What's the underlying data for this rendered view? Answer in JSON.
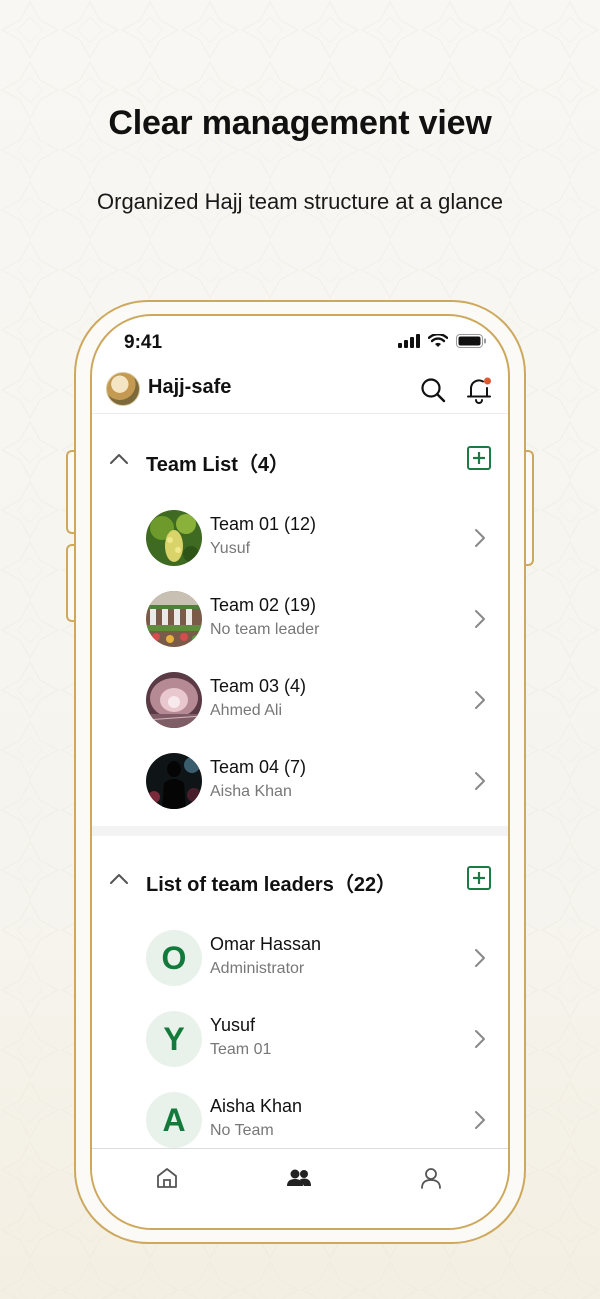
{
  "promo": {
    "headline": "Clear management view",
    "subline": "Organized Hajj team structure at a glance"
  },
  "status_bar": {
    "time": "9:41",
    "icons": [
      "signal-icon",
      "wifi-icon",
      "battery-icon"
    ]
  },
  "header": {
    "app_title": "Hajj-safe",
    "icons": [
      "search-icon",
      "bell-icon"
    ],
    "notification_dot_color": "#e0562f"
  },
  "team_list": {
    "title": "Team List（4）",
    "teams": [
      {
        "name": "Team 01 (12)",
        "leader": "Yusuf"
      },
      {
        "name": "Team 02 (19)",
        "leader": "No team leader"
      },
      {
        "name": "Team 03 (4)",
        "leader": "Ahmed Ali"
      },
      {
        "name": "Team 04 (7)",
        "leader": "Aisha Khan"
      }
    ]
  },
  "leaders_list": {
    "title": "List of team leaders（22）",
    "leaders": [
      {
        "initial": "O",
        "name": "Omar Hassan",
        "role": "Administrator"
      },
      {
        "initial": "Y",
        "name": "Yusuf",
        "role": "Team 01"
      },
      {
        "initial": "A",
        "name": "Aisha Khan",
        "role": "No Team"
      }
    ]
  },
  "tab_bar": {
    "tabs": [
      "home-icon",
      "team-icon",
      "profile-icon"
    ],
    "active": "team-icon"
  },
  "colors": {
    "accent_green": "#1c7a45",
    "frame_gold": "#cda85d",
    "avatar_bg": "#e8f2ea"
  }
}
